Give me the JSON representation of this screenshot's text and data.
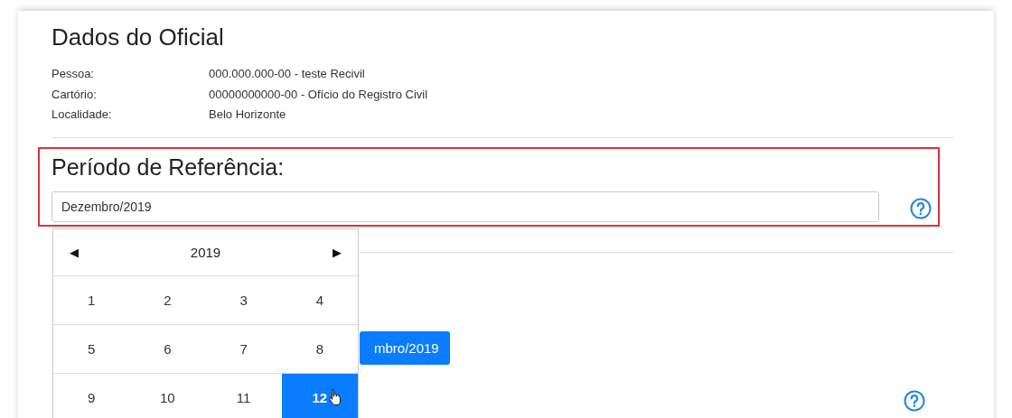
{
  "heading": "Dados do Oficial",
  "details": [
    {
      "label": "Pessoa:",
      "value": "000.000.000-00 - teste Recivil"
    },
    {
      "label": "Cartório:",
      "value": "00000000000-00 - Ofício do Registro Civil"
    },
    {
      "label": "Localidade:",
      "value": "Belo Horizonte"
    }
  ],
  "period": {
    "title": "Período de Referência:",
    "value": "Dezembro/2019"
  },
  "month_picker": {
    "prev": "◀",
    "year": "2019",
    "next": "▶",
    "months": [
      {
        "label": "1",
        "selected": false
      },
      {
        "label": "2",
        "selected": false
      },
      {
        "label": "3",
        "selected": false
      },
      {
        "label": "4",
        "selected": false
      },
      {
        "label": "5",
        "selected": false
      },
      {
        "label": "6",
        "selected": false
      },
      {
        "label": "7",
        "selected": false
      },
      {
        "label": "8",
        "selected": false
      },
      {
        "label": "9",
        "selected": false
      },
      {
        "label": "10",
        "selected": false
      },
      {
        "label": "11",
        "selected": false
      },
      {
        "label": "12",
        "selected": true
      }
    ]
  },
  "button": {
    "label": "mbro/2019"
  }
}
